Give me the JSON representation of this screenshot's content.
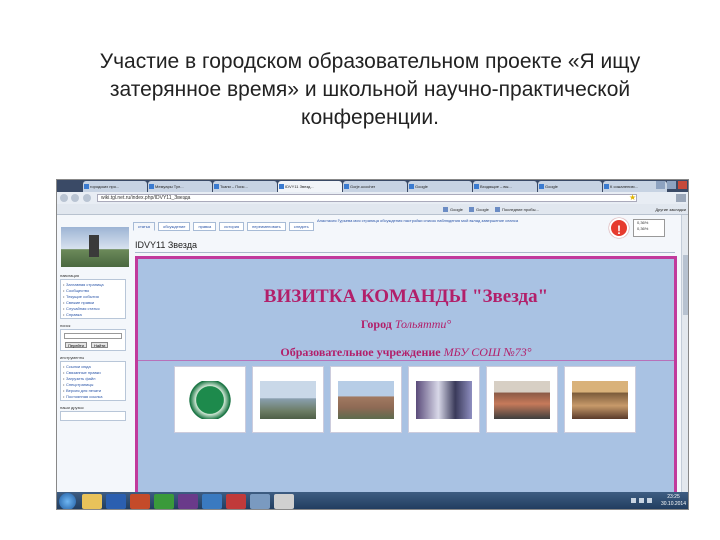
{
  "slide": {
    "title": "Участие в городском образовательном проекте  «Я ищу затерянное время» и школьной научно-практической конференции."
  },
  "browser": {
    "tabs": [
      {
        "label": "городских про..."
      },
      {
        "label": "Мемуары Тул..."
      },
      {
        "label": "Ткани – Поис..."
      },
      {
        "label": "IDVY11 Звезд..."
      },
      {
        "label": "Gorje.ucocher"
      },
      {
        "label": "Google"
      },
      {
        "label": "Входящие – вы..."
      },
      {
        "label": "Google"
      },
      {
        "label": "К сожалению..."
      }
    ],
    "url": "wiki.tgl.net.ru/index.php/IDVY11_Звезда",
    "bookmarks": [
      {
        "label": "Google"
      },
      {
        "label": "Google"
      },
      {
        "label": "Последние пробы..."
      }
    ],
    "bookmarks_right": "Другие закладки"
  },
  "wiki": {
    "page_tabs": [
      "статья",
      "обсуждение",
      "правка",
      "история",
      "переименовать",
      "следить"
    ],
    "user_links": "Анастасия Гурьева   моя страница обсуждения   настройки   список наблюдения   мой вклад   завершение сеанса",
    "page_heading": "IDVY11 Звезда",
    "sidebar": {
      "nav_heading": "навигация",
      "nav_items": [
        "Заглавная страница",
        "Сообщество",
        "Текущие события",
        "Свежие правки",
        "Случайная статья",
        "Справка"
      ],
      "search_heading": "поиск",
      "search_go": "Перейти",
      "search_find": "Найти",
      "tools_heading": "инструменты",
      "tools_items": [
        "Ссылки сюда",
        "Связанные правки",
        "Загрузить файл",
        "Спецстраницы",
        "Версия для печати",
        "Постоянная ссылка"
      ],
      "friends_heading": "наши друзья"
    },
    "popup": [
      "0,36%",
      "0,36%"
    ]
  },
  "card": {
    "title": "ВИЗИТКА КОМАНДЫ \"Звезда\"",
    "city_label": "Город",
    "city_value": "Тольятти",
    "school_label": "Образовательное учреждение",
    "school_value": "МБУ СОШ №73"
  },
  "taskbar": {
    "time": "23:25",
    "date": "30.10.2014"
  },
  "colors": {
    "card_background": "#a9c2e3",
    "card_border": "#c13a9c",
    "card_text": "#b21f6a"
  }
}
